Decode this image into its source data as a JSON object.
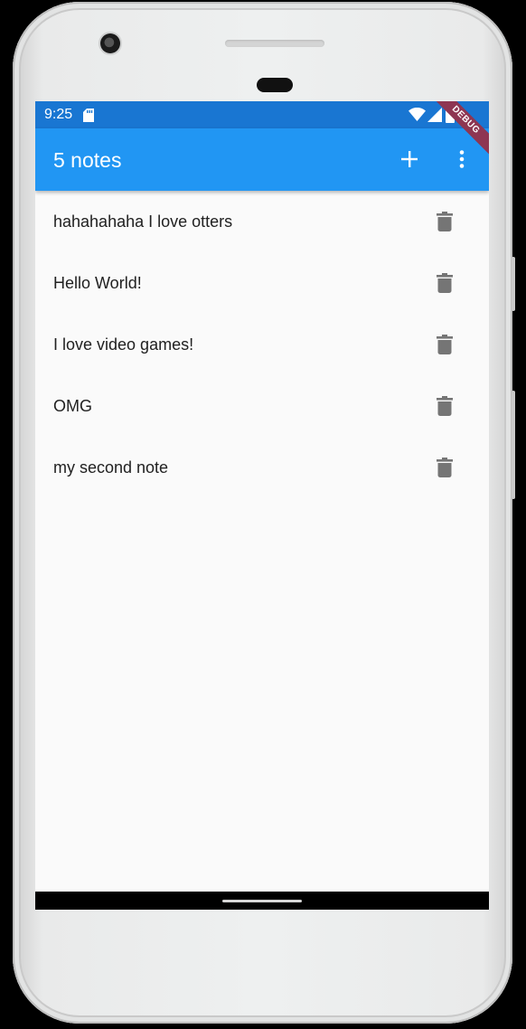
{
  "status_bar": {
    "time": "9:25",
    "icons": [
      "sd-card-icon",
      "wifi-icon",
      "cell-signal-icon",
      "battery-icon"
    ],
    "color": "#1976d2"
  },
  "app_bar": {
    "title": "5 notes",
    "actions": [
      "add-icon",
      "more-vert-icon"
    ],
    "color": "#2196f3"
  },
  "debug_banner": {
    "label": "DEBUG",
    "color": "#8e3652"
  },
  "notes": [
    {
      "text": "hahahahaha I love otters",
      "action_icon": "delete-icon"
    },
    {
      "text": "Hello World!",
      "action_icon": "delete-icon"
    },
    {
      "text": "I love video games!",
      "action_icon": "delete-icon"
    },
    {
      "text": "OMG",
      "action_icon": "delete-icon"
    },
    {
      "text": "my second note",
      "action_icon": "delete-icon"
    }
  ],
  "colors": {
    "list_background": "#fafafa",
    "note_text": "#212121",
    "delete_icon": "#757575"
  }
}
